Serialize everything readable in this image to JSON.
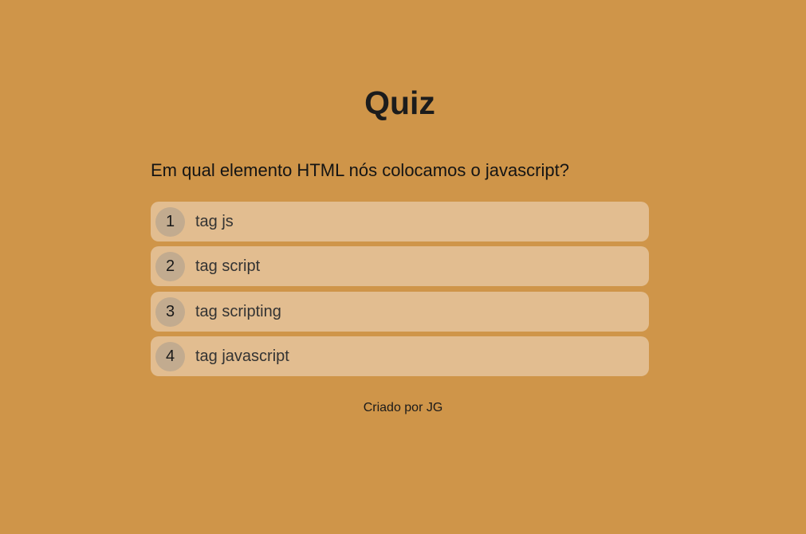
{
  "quiz": {
    "title": "Quiz",
    "question": "Em qual elemento HTML nós colocamos o javascript?",
    "answers": [
      {
        "number": "1",
        "text": "tag js"
      },
      {
        "number": "2",
        "text": "tag script"
      },
      {
        "number": "3",
        "text": "tag scripting"
      },
      {
        "number": "4",
        "text": "tag javascript"
      }
    ]
  },
  "footer": {
    "text": "Criado por JG"
  },
  "colors": {
    "background": "#cf9549",
    "answer_background": "#e2bd90",
    "number_badge": "#c2ab8f"
  }
}
